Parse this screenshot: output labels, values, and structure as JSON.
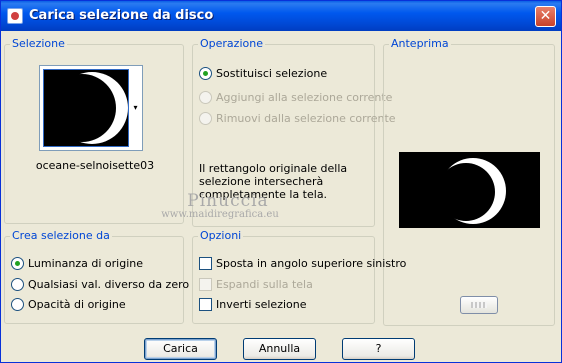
{
  "window": {
    "title": "Carica selezione da disco",
    "close_glyph": "✕"
  },
  "selezione": {
    "legend": "Selezione",
    "file_name": "oceane-selnoisette03",
    "dropdown_glyph": "▾"
  },
  "operazione": {
    "legend": "Operazione",
    "options": [
      {
        "label": "Sostituisci selezione",
        "checked": true,
        "enabled": true
      },
      {
        "label": "Aggiungi alla selezione corrente",
        "checked": false,
        "enabled": false
      },
      {
        "label": "Rimuovi dalla selezione corrente",
        "checked": false,
        "enabled": false
      }
    ],
    "info": "Il rettangolo originale della selezione intersecherà completamente la tela."
  },
  "anteprima": {
    "legend": "Anteprima"
  },
  "crea": {
    "legend": "Crea selezione da",
    "options": [
      {
        "label": "Luminanza di origine",
        "checked": true
      },
      {
        "label": "Qualsiasi val. diverso da zero",
        "checked": false
      },
      {
        "label": "Opacità di origine",
        "checked": false
      }
    ]
  },
  "opzioni": {
    "legend": "Opzioni",
    "checks": [
      {
        "label": "Sposta in angolo superiore sinistro",
        "checked": false,
        "enabled": true
      },
      {
        "label": "Espandi sulla tela",
        "checked": false,
        "enabled": false
      },
      {
        "label": "Inverti selezione",
        "checked": false,
        "enabled": true
      }
    ]
  },
  "watermark": {
    "name": "Pinuccia",
    "url": "www.maidiregrafica.eu"
  },
  "buttons": {
    "load": "Carica",
    "cancel": "Annulla",
    "help": "?"
  },
  "colors": {
    "title_bar": "#0058ee",
    "legend_text": "#0046d5",
    "dialog_bg": "#ece9d8",
    "selection_black": "#000000",
    "moon_white": "#ffffff"
  }
}
